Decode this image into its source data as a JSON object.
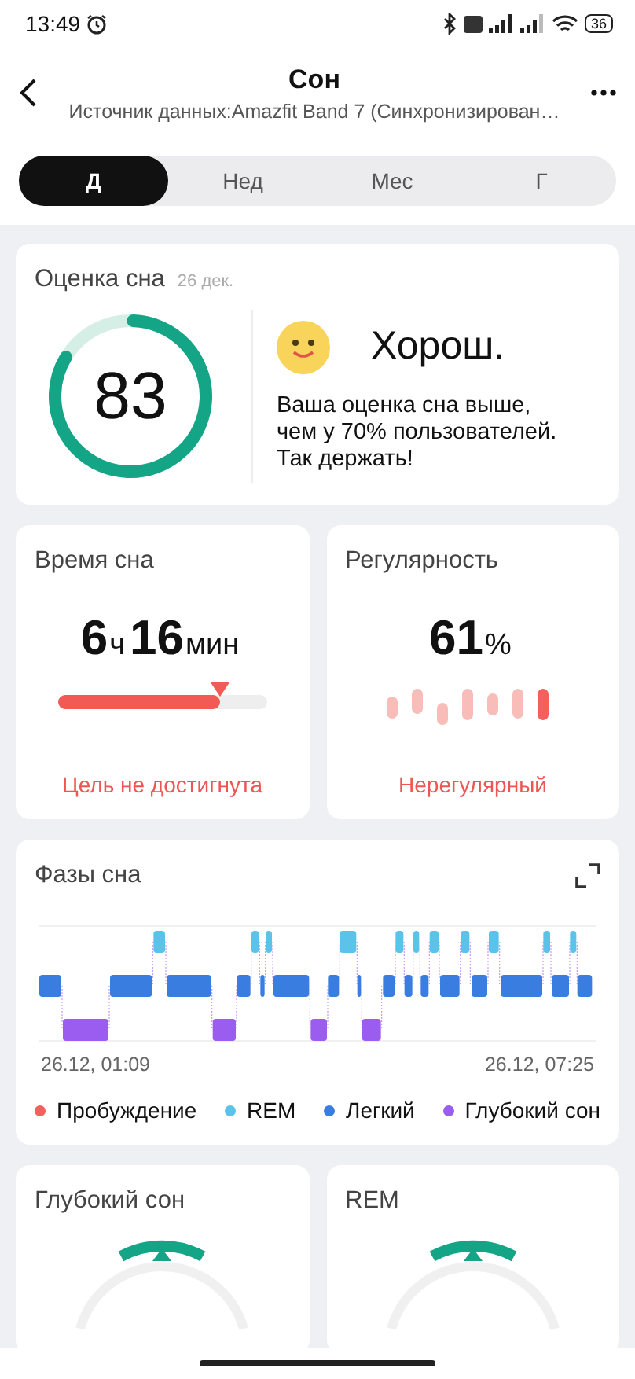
{
  "status_bar": {
    "time": "13:49",
    "battery": "36"
  },
  "header": {
    "title": "Сон",
    "subtitle": "Источник данных:Amazfit Band 7 (Синхронизирован…"
  },
  "tabs": [
    {
      "label": "Д",
      "selected": true
    },
    {
      "label": "Нед",
      "selected": false
    },
    {
      "label": "Мес",
      "selected": false
    },
    {
      "label": "Г",
      "selected": false
    }
  ],
  "score_card": {
    "title": "Оценка сна",
    "date": "26 дек.",
    "score": "83",
    "rating": "Хорош.",
    "description": "Ваша оценка сна выше, чем у 70% пользователей. Так держать!"
  },
  "duration_card": {
    "title": "Время сна",
    "hours": "6",
    "hours_unit": "ч",
    "minutes": "16",
    "minutes_unit": "мин",
    "level": 0.78,
    "status": "Цель не достигнута"
  },
  "regularity_card": {
    "title": "Регулярность",
    "value": "61",
    "unit": "%",
    "status": "Нерегулярный"
  },
  "phases_card": {
    "title": "Фазы сна",
    "start": "26.12, 01:09",
    "end": "26.12, 07:25",
    "legend": [
      {
        "label": "Пробуждение",
        "color": "#f4605b"
      },
      {
        "label": "REM",
        "color": "#5bc3ea"
      },
      {
        "label": "Легкий",
        "color": "#3a7de0"
      },
      {
        "label": "Глубокий сон",
        "color": "#9b5cf0"
      }
    ]
  },
  "stage_cards": [
    {
      "title": "Глубокий сон"
    },
    {
      "title": "REM"
    }
  ]
}
